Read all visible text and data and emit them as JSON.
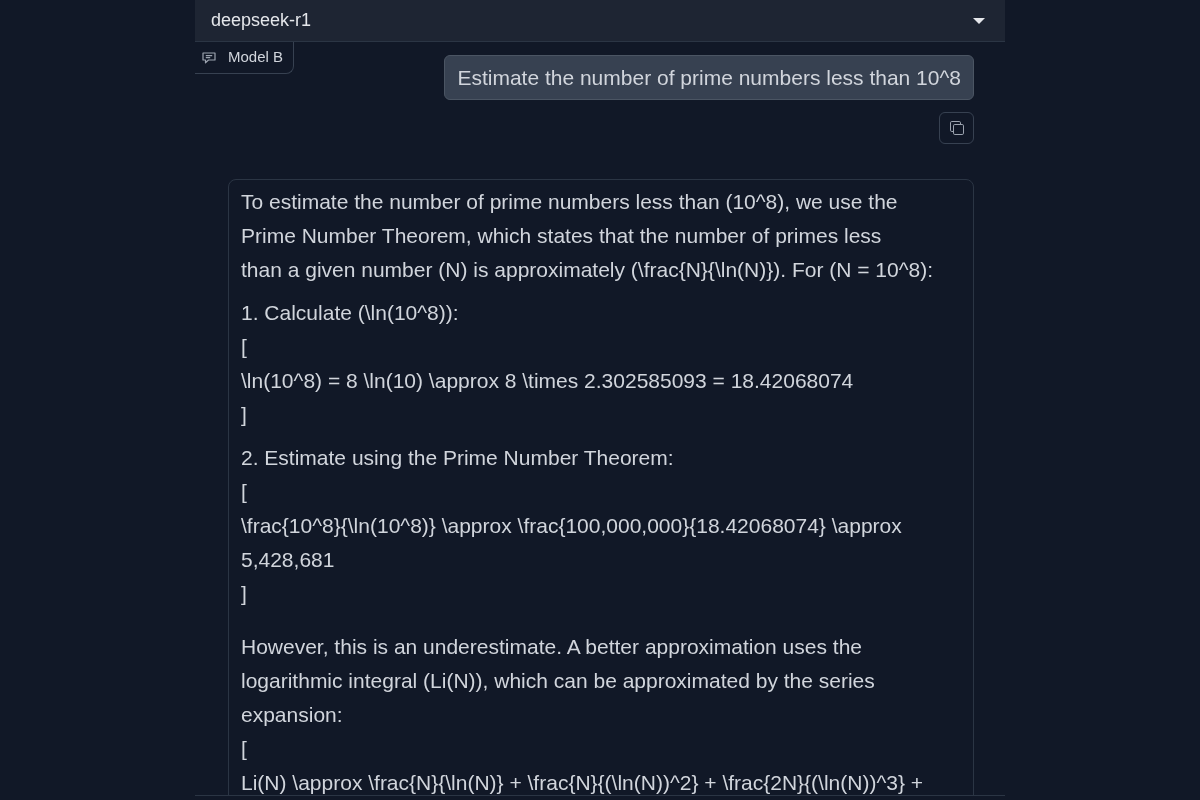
{
  "model_dropdown": {
    "value": "deepseek-r1"
  },
  "model_tag": {
    "label": "Model B"
  },
  "messages": [
    {
      "kind": "user",
      "text": "Estimate the number of prime numbers less than 10^8"
    },
    {
      "kind": "assistant",
      "blocks": [
        {
          "kind": "paragraph",
          "lines": [
            {
              "rows": [
                "To estimate the number of prime numbers less than (10^8), we use the",
                "Prime Number Theorem, which states that the number of primes less",
                "than a given number (N) is approximately (\\frac{N}{\\ln(N)}). For (N = 10^8):"
              ]
            }
          ]
        },
        {
          "kind": "list_item",
          "lines": [
            {
              "rows": [
                "1. Calculate (\\ln(10^8)):"
              ]
            },
            {
              "rows": [
                "["
              ]
            },
            {
              "rows": [
                "\\ln(10^8) = 8 \\ln(10) \\approx 8 \\times 2.302585093 = 18.42068074"
              ]
            },
            {
              "rows": [
                "]"
              ]
            }
          ]
        },
        {
          "kind": "list_item",
          "lines": [
            {
              "rows": [
                "2. Estimate using the Prime Number Theorem:"
              ]
            },
            {
              "rows": [
                "["
              ]
            },
            {
              "rows": [
                "\\frac{10^8}{\\ln(10^8)} \\approx \\frac{100,000,000}{18.42068074} \\approx",
                "5,428,681"
              ]
            },
            {
              "rows": [
                "]"
              ]
            }
          ]
        },
        {
          "kind": "paragraph",
          "lines": [
            {
              "rows": [
                "However, this is an underestimate. A better approximation uses the",
                "logarithmic integral (Li(N)), which can be approximated by the series",
                "expansion:"
              ]
            },
            {
              "rows": [
                "["
              ]
            },
            {
              "rows": [
                "Li(N) \\approx \\frac{N}{\\ln(N)} + \\frac{N}{(\\ln(N))^2} + \\frac{2N}{(\\ln(N))^3} +"
              ]
            }
          ]
        }
      ]
    }
  ]
}
